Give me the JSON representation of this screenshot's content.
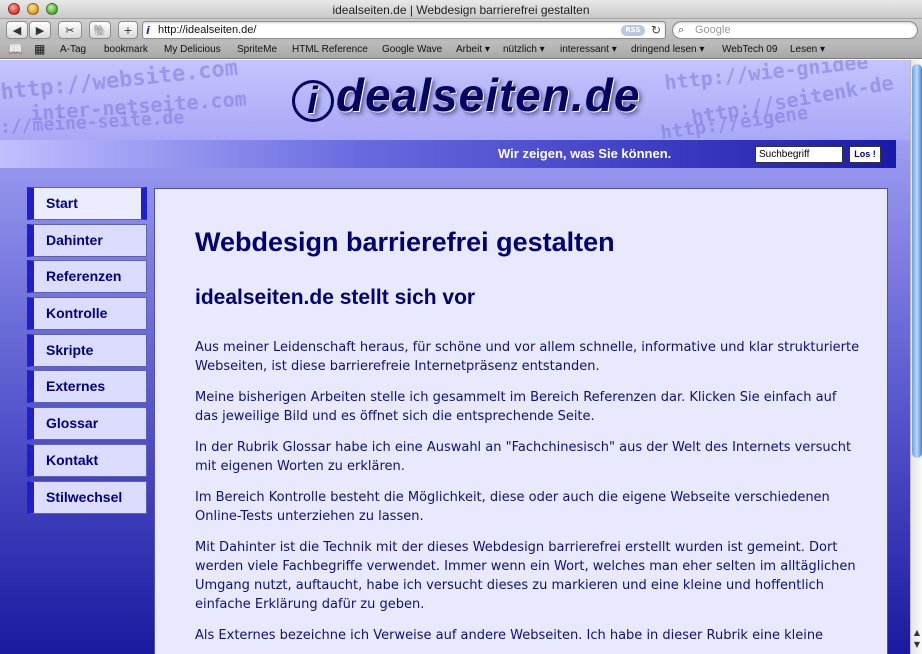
{
  "window": {
    "title": "idealseiten.de | Webdesign barrierefrei gestalten"
  },
  "toolbar": {
    "back": "◀",
    "forward": "▶",
    "add": "+",
    "url": "http://idealseiten.de/",
    "rss": "RSS",
    "search_placeholder": "Google"
  },
  "bookmarks": [
    "A-Tag",
    "bookmark",
    "My Delicious",
    "SpriteMe",
    "HTML Reference",
    "Google Wave",
    "Arbeit ▾",
    "nützlich ▾",
    "interessant ▾",
    "dringend lesen ▾",
    "WebTech 09",
    "Lesen ▾"
  ],
  "header": {
    "logo_initial": "i",
    "logo_text": "dealseiten.de",
    "slogan": "Wir zeigen, was Sie können.",
    "search_value": "Suchbegriff",
    "search_button": "Los !",
    "deco": [
      "http://website.com",
      "http://wie-gnidee",
      "http://seitenk-de",
      "http://eigene",
      "inter-netseite.com",
      "://meine-seite.de"
    ]
  },
  "nav": [
    "Start",
    "Dahinter",
    "Referenzen",
    "Kontrolle",
    "Skripte",
    "Externes",
    "Glossar",
    "Kontakt",
    "Stilwechsel"
  ],
  "main": {
    "title": "Webdesign barrierefrei gestalten",
    "subtitle": "idealseiten.de stellt sich vor",
    "paragraphs": [
      "Aus meiner Leidenschaft heraus, für schöne und vor allem schnelle, informative und klar strukturierte Webseiten, ist diese barrierefreie Internetpräsenz entstanden.",
      "Meine bisherigen Arbeiten stelle ich gesammelt im Bereich Referenzen dar. Klicken Sie einfach auf das jeweilige Bild und es öffnet sich die entsprechende Seite.",
      "In der Rubrik Glossar habe ich eine Auswahl an \"Fachchinesisch\" aus der Welt des Internets versucht mit eigenen Worten zu erklären.",
      "Im Bereich Kontrolle besteht die Möglichkeit, diese oder auch die eigene Webseite verschiedenen Online-Tests unterziehen zu lassen.",
      "Mit Dahinter ist die Technik mit der dieses Webdesign barrierefrei erstellt wurden ist gemeint. Dort werden viele Fachbegriffe verwendet. Immer wenn ein Wort, welches man eher selten im alltäglichen Umgang nutzt, auftaucht, habe ich versucht dieses zu markieren und eine kleine und hoffentlich einfache Erklärung dafür zu geben.",
      "Als Externes bezeichne ich Verweise auf andere Webseiten. Ich habe in dieser Rubrik eine kleine"
    ]
  }
}
